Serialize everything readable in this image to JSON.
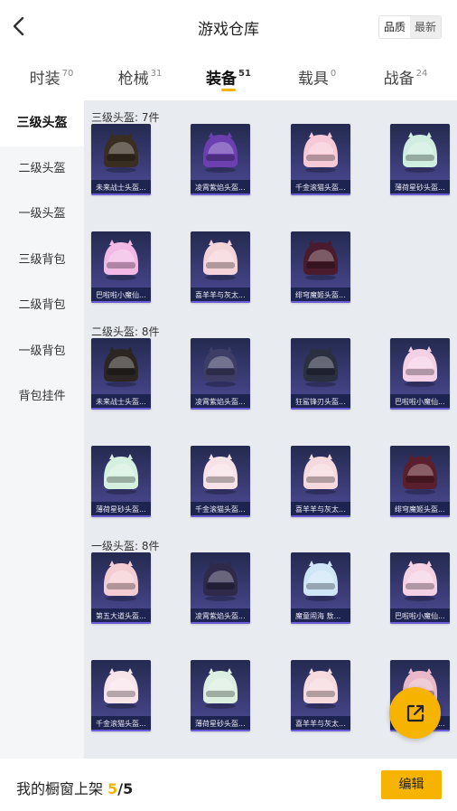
{
  "header": {
    "title": "游戏仓库",
    "sort_options": [
      "品质",
      "最新"
    ]
  },
  "tabs": [
    {
      "label": "时装",
      "count": "70"
    },
    {
      "label": "枪械",
      "count": "31"
    },
    {
      "label": "装备",
      "count": "51"
    },
    {
      "label": "载具",
      "count": "0"
    },
    {
      "label": "战备",
      "count": "24"
    }
  ],
  "sidebar": {
    "items": [
      {
        "label": "三级头盔"
      },
      {
        "label": "二级头盔"
      },
      {
        "label": "一级头盔"
      },
      {
        "label": "三级背包"
      },
      {
        "label": "二级背包"
      },
      {
        "label": "一级背包"
      },
      {
        "label": "背包挂件"
      }
    ]
  },
  "sections": [
    {
      "title": "三级头盔: 7件",
      "items": [
        {
          "name": "未来战士头盔...",
          "color": "#3a2e22"
        },
        {
          "name": "凌霄紫焰头盔...",
          "color": "#6b3fb0"
        },
        {
          "name": "千金滚猫头盔...",
          "color": "#f7c9d6"
        },
        {
          "name": "薄荷星砂头盔...",
          "color": "#cfeee0"
        },
        {
          "name": "巴啦啦小魔仙...",
          "color": "#f3b9e6"
        },
        {
          "name": "喜羊羊与灰太...",
          "color": "#f4d3d9"
        },
        {
          "name": "绯穹魔姬头盔...",
          "color": "#4a1b2c"
        }
      ]
    },
    {
      "title": "二级头盔: 8件",
      "items": [
        {
          "name": "未来战士头盔...",
          "color": "#2c2622"
        },
        {
          "name": "凌霄紫焰头盔...",
          "color": "#3e3d66"
        },
        {
          "name": "狂鲨锋刃头盔...",
          "color": "#2b3040"
        },
        {
          "name": "巴啦啦小魔仙...",
          "color": "#f4d0e6"
        },
        {
          "name": "薄荷星砂头盔...",
          "color": "#d6f0df"
        },
        {
          "name": "千金滚猫头盔...",
          "color": "#f7e2e8"
        },
        {
          "name": "喜羊羊与灰太...",
          "color": "#f5d9dd"
        },
        {
          "name": "绯穹魔姬头盔...",
          "color": "#5a1f2c"
        }
      ]
    },
    {
      "title": "一级头盔: 8件",
      "items": [
        {
          "name": "第五大道头盔...",
          "color": "#f4cdd3"
        },
        {
          "name": "凌霄紫焰头盔...",
          "color": "#2f2a4a"
        },
        {
          "name": "魔童闹海 敖...",
          "color": "#cfe6f7"
        },
        {
          "name": "巴啦啦小魔仙...",
          "color": "#f4d2e3"
        },
        {
          "name": "千金滚猫头盔...",
          "color": "#f8e5ea"
        },
        {
          "name": "薄荷星砂头盔...",
          "color": "#dcefe0"
        },
        {
          "name": "喜羊羊与灰太...",
          "color": "#f6dade"
        },
        {
          "name": "绯穹魔姬头盔...",
          "color": "#e9b9c9"
        }
      ]
    }
  ],
  "bottom": {
    "prefix": "我的橱窗上架 ",
    "current": "5",
    "sep": "/",
    "total": "5",
    "edit_label": "编辑"
  }
}
